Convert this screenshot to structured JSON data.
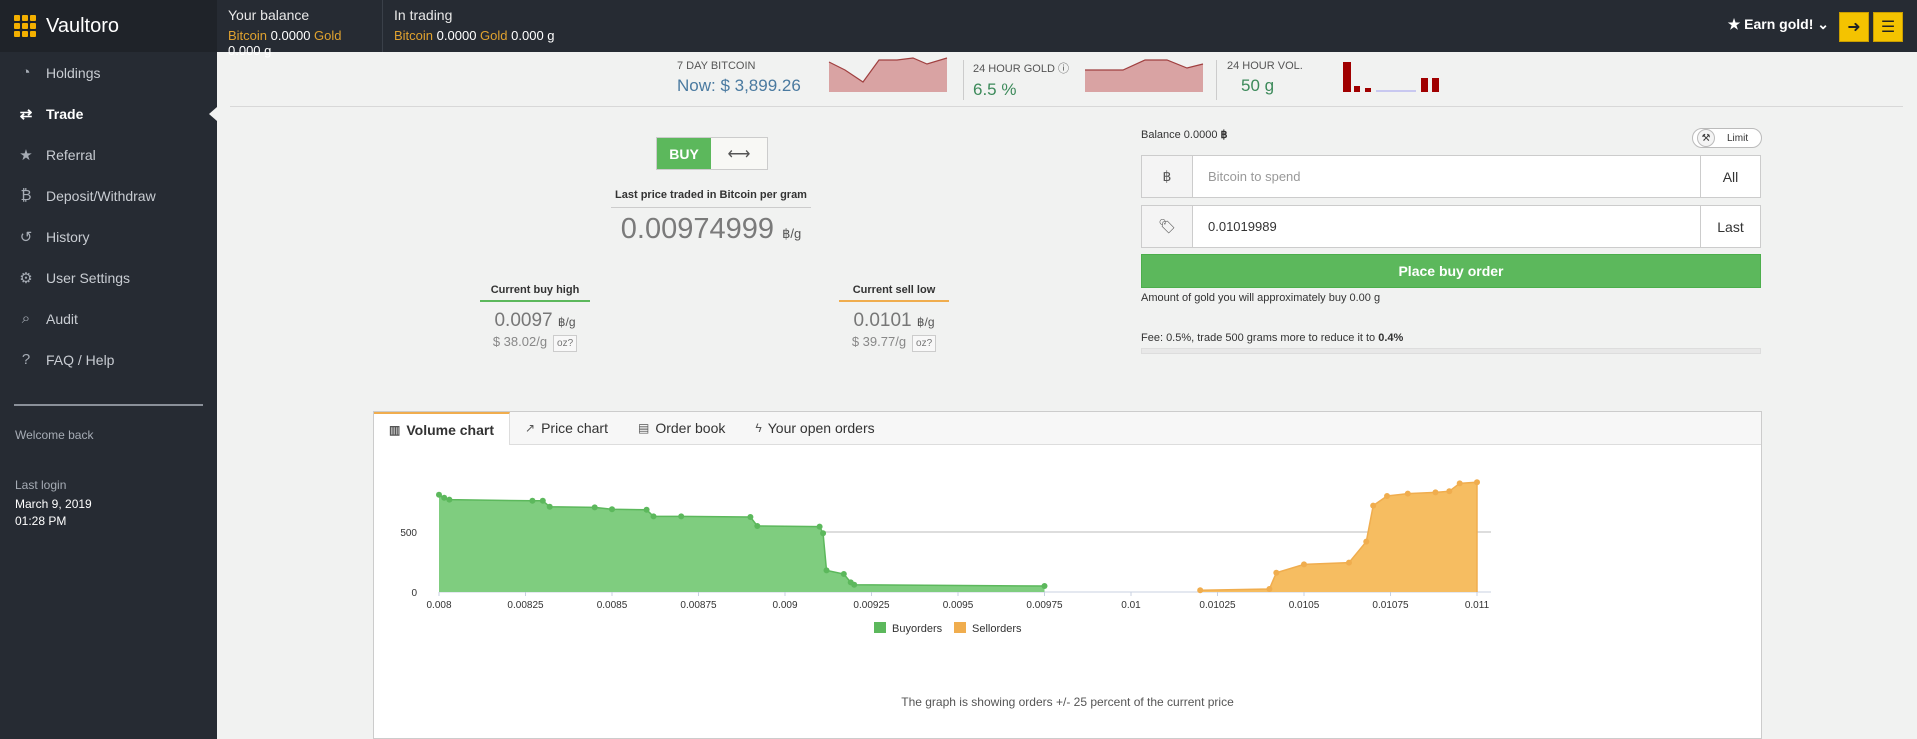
{
  "brand": {
    "name": "Vaultoro"
  },
  "sidebar": {
    "items": [
      {
        "label": "Holdings",
        "icon": "dashboard-icon",
        "glyph": "◔"
      },
      {
        "label": "Trade",
        "icon": "exchange-icon",
        "glyph": "⇄"
      },
      {
        "label": "Referral",
        "icon": "star-icon",
        "glyph": "★"
      },
      {
        "label": "Deposit/Withdraw",
        "icon": "bitcoin-icon",
        "glyph": "₿"
      },
      {
        "label": "History",
        "icon": "history-icon",
        "glyph": "↺"
      },
      {
        "label": "User Settings",
        "icon": "gear-icon",
        "glyph": "⚙"
      },
      {
        "label": "Audit",
        "icon": "search-icon",
        "glyph": "⌕"
      },
      {
        "label": "FAQ / Help",
        "icon": "question-icon",
        "glyph": "?"
      }
    ],
    "active": "Trade",
    "welcome": "Welcome back",
    "last_login_label": "Last login",
    "last_login_date": "March 9, 2019",
    "last_login_time": "01:28 PM"
  },
  "topbar": {
    "balance_title": "Your balance",
    "balance_btc_label": "Bitcoin",
    "balance_btc": "0.0000",
    "balance_gold_label": "Gold",
    "balance_gold": "0.000 g",
    "trading_title": "In trading",
    "trading_btc_label": "Bitcoin",
    "trading_btc": "0.0000",
    "trading_gold_label": "Gold",
    "trading_gold": "0.000 g",
    "earn_label": "★ Earn gold! ⌄"
  },
  "stats": {
    "btc_label": "7 DAY BITCOIN",
    "btc_value": "Now: $ 3,899.26",
    "gold_label": "24 HOUR GOLD",
    "gold_value": "6.5 %",
    "vol_label": "24 HOUR VOL.",
    "vol_value": "50 g"
  },
  "trade": {
    "buy_label": "BUY",
    "swap_glyph": "⟷",
    "last_price_label": "Last price traded in Bitcoin per gram",
    "last_price": "0.00974999",
    "unit": "฿/g",
    "buy_high_label": "Current buy high",
    "buy_high": "0.0097",
    "buy_high_usd": "$ 38.02/g",
    "sell_low_label": "Current sell low",
    "sell_low": "0.0101",
    "sell_low_usd": "$ 39.77/g",
    "oz_label": "oz?"
  },
  "order": {
    "balance_label": "Balance 0.0000",
    "btc_glyph": "฿",
    "limit_label": "Limit",
    "spend_placeholder": "Bitcoin to spend",
    "all_label": "All",
    "price_value": "0.01019989",
    "last_label": "Last",
    "place_label": "Place buy order",
    "approx_text": "Amount of gold you will approximately buy 0.00 g",
    "fee_text": "Fee: 0.5%, trade 500 grams more to reduce it to ",
    "fee_bold": "0.4%"
  },
  "tabs": [
    {
      "label": "Volume chart",
      "glyph": "▥"
    },
    {
      "label": "Price chart",
      "glyph": "↗"
    },
    {
      "label": "Order book",
      "glyph": "▤"
    },
    {
      "label": "Your open orders",
      "glyph": "ϟ"
    }
  ],
  "chart_note": "The graph is showing orders +/- 25 percent of the current price",
  "colors": {
    "buy": "#5cb85c",
    "sell": "#f0ad4e",
    "buy_fill": "#7fcd7f",
    "sell_fill": "#f6bd61"
  },
  "chart_data": {
    "type": "area",
    "x_ticks": [
      "0.008",
      "0.00825",
      "0.0085",
      "0.00875",
      "0.009",
      "0.00925",
      "0.0095",
      "0.00975",
      "0.01",
      "0.01025",
      "0.0105",
      "0.01075",
      "0.011"
    ],
    "y_ticks": [
      "0",
      "500"
    ],
    "xlim": [
      0.008,
      0.011
    ],
    "ylim": [
      0,
      1000
    ],
    "legend_position": "bottom",
    "series": [
      {
        "name": "Buyorders",
        "color": "#5cb85c",
        "points": [
          [
            0.008,
            810
          ],
          [
            0.008015,
            785
          ],
          [
            0.00803,
            770
          ],
          [
            0.00827,
            760
          ],
          [
            0.0083,
            760
          ],
          [
            0.00832,
            710
          ],
          [
            0.00845,
            705
          ],
          [
            0.0085,
            690
          ],
          [
            0.0086,
            685
          ],
          [
            0.00862,
            630
          ],
          [
            0.0087,
            630
          ],
          [
            0.0089,
            625
          ],
          [
            0.00892,
            550
          ],
          [
            0.0091,
            545
          ],
          [
            0.00911,
            490
          ],
          [
            0.00912,
            180
          ],
          [
            0.00917,
            150
          ],
          [
            0.00919,
            80
          ],
          [
            0.0092,
            60
          ],
          [
            0.00975,
            50
          ]
        ]
      },
      {
        "name": "Sellorders",
        "color": "#f0ad4e",
        "points": [
          [
            0.0102,
            15
          ],
          [
            0.0104,
            25
          ],
          [
            0.01042,
            160
          ],
          [
            0.0105,
            230
          ],
          [
            0.01063,
            245
          ],
          [
            0.01068,
            420
          ],
          [
            0.0107,
            720
          ],
          [
            0.01074,
            800
          ],
          [
            0.0108,
            820
          ],
          [
            0.01088,
            830
          ],
          [
            0.01092,
            840
          ],
          [
            0.01095,
            905
          ],
          [
            0.011,
            915
          ],
          [
            0.011,
            0
          ]
        ]
      }
    ]
  }
}
